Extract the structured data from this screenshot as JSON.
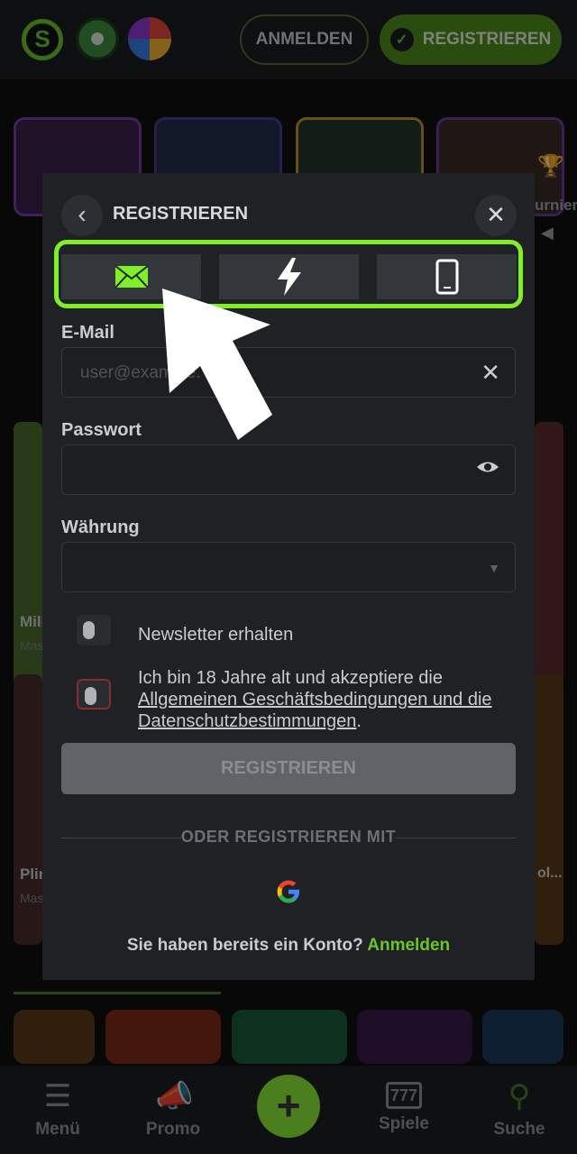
{
  "header": {
    "login_label": "ANMELDEN",
    "register_label": "REGISTRIEREN"
  },
  "background": {
    "side_label": "urnier",
    "game1_title": "Mill",
    "game1_provider": "Mas",
    "game2_title": "Plin",
    "game2_provider": "Mas",
    "game3_suffix": "ol..."
  },
  "modal": {
    "title": "REGISTRIEREN",
    "tabs": [
      {
        "icon": "envelope-icon",
        "active": true
      },
      {
        "icon": "lightning-icon",
        "active": false
      },
      {
        "icon": "phone-icon",
        "active": false
      }
    ],
    "email_label": "E-Mail",
    "email_placeholder": "user@example.",
    "password_label": "Passwort",
    "currency_label": "Währung",
    "newsletter_label": "Newsletter erhalten",
    "terms_text_prefix": "Ich bin 18 Jahre alt und akzeptiere die",
    "terms_link": "Allgemeinen Geschäftsbedingungen und die",
    "privacy_link": "Datenschutzbestimmungen",
    "terms_text_suffix": ".",
    "submit_label": "REGISTRIEREN",
    "divider_label": "ODER REGISTRIEREN MIT",
    "google_letter": "G",
    "footer_text": "Sie haben bereits ein Konto?",
    "footer_link": "Anmelden"
  },
  "bottom_nav": {
    "items": [
      {
        "label": "Menü",
        "icon": "menu-icon"
      },
      {
        "label": "Promo",
        "icon": "megaphone-icon"
      },
      {
        "label": "Spiele",
        "icon": "slot-777-icon"
      },
      {
        "label": "Suche",
        "icon": "search-icon"
      }
    ]
  },
  "colors": {
    "accent": "#6cc42b",
    "highlight": "#7ff025"
  }
}
